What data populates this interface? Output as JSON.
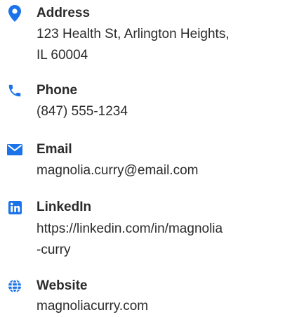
{
  "accent_color": "#1a73e8",
  "contacts": [
    {
      "icon": "map-pin-icon",
      "label": "Address",
      "lines": [
        "123 Health St, Arlington Heights,",
        "IL 60004"
      ]
    },
    {
      "icon": "phone-icon",
      "label": "Phone",
      "lines": [
        "(847) 555-1234"
      ]
    },
    {
      "icon": "email-icon",
      "label": "Email",
      "lines": [
        "magnolia.curry@email.com"
      ]
    },
    {
      "icon": "linkedin-icon",
      "label": "LinkedIn",
      "lines": [
        "https://linkedin.com/in/magnolia",
        "-curry"
      ]
    },
    {
      "icon": "globe-icon",
      "label": "Website",
      "lines": [
        "magnoliacurry.com"
      ]
    }
  ]
}
